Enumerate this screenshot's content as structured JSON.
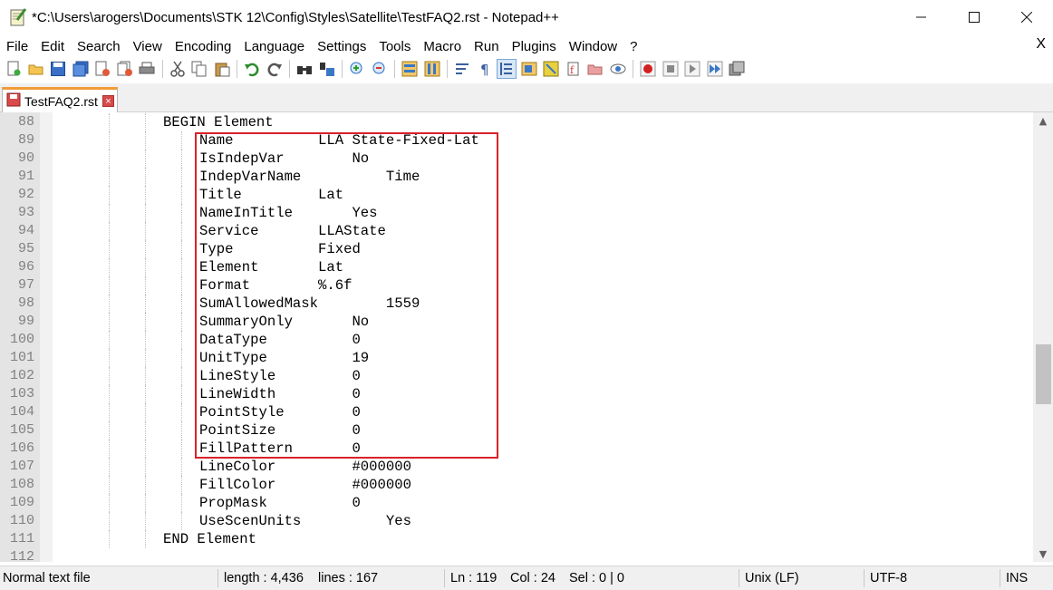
{
  "window": {
    "title": "*C:\\Users\\arogers\\Documents\\STK 12\\Config\\Styles\\Satellite\\TestFAQ2.rst - Notepad++",
    "minimize_icon": "minimize-icon",
    "maximize_icon": "maximize-icon",
    "close_icon": "close-icon"
  },
  "menu": {
    "items": [
      "File",
      "Edit",
      "Search",
      "View",
      "Encoding",
      "Language",
      "Settings",
      "Tools",
      "Macro",
      "Run",
      "Plugins",
      "Window",
      "?"
    ],
    "close_label": "X"
  },
  "toolbar": {
    "buttons": [
      "new-file-icon",
      "open-file-icon",
      "save-icon",
      "save-all-icon",
      "close-icon",
      "close-all-icon",
      "print-icon",
      "cut-icon",
      "copy-icon",
      "paste-icon",
      "undo-icon",
      "redo-icon",
      "find-icon",
      "replace-icon",
      "zoom-in-icon",
      "zoom-out-icon",
      "sync-vertical-icon",
      "sync-horizontal-icon",
      "word-wrap-icon",
      "show-all-chars-icon",
      "indent-guide-icon",
      "document-map-icon",
      "function-list-icon",
      "folder-as-workspace-icon",
      "monitoring-icon",
      "record-macro-icon",
      "stop-macro-icon",
      "play-macro-icon",
      "run-macro-multiple-icon",
      "save-macro-icon"
    ]
  },
  "tab": {
    "label": "TestFAQ2.rst",
    "icon": "save-disk-icon",
    "close": "×"
  },
  "editor": {
    "lines": [
      {
        "num": "88",
        "indent": 3,
        "text": "BEGIN Element"
      },
      {
        "num": "89",
        "indent": 4,
        "text": "Name          LLA State-Fixed-Lat"
      },
      {
        "num": "90",
        "indent": 4,
        "text": "IsIndepVar        No"
      },
      {
        "num": "91",
        "indent": 4,
        "text": "IndepVarName          Time"
      },
      {
        "num": "92",
        "indent": 4,
        "text": "Title         Lat"
      },
      {
        "num": "93",
        "indent": 4,
        "text": "NameInTitle       Yes"
      },
      {
        "num": "94",
        "indent": 4,
        "text": "Service       LLAState"
      },
      {
        "num": "95",
        "indent": 4,
        "text": "Type          Fixed"
      },
      {
        "num": "96",
        "indent": 4,
        "text": "Element       Lat"
      },
      {
        "num": "97",
        "indent": 4,
        "text": "Format        %.6f"
      },
      {
        "num": "98",
        "indent": 4,
        "text": "SumAllowedMask        1559"
      },
      {
        "num": "99",
        "indent": 4,
        "text": "SummaryOnly       No"
      },
      {
        "num": "100",
        "indent": 4,
        "text": "DataType          0"
      },
      {
        "num": "101",
        "indent": 4,
        "text": "UnitType          19"
      },
      {
        "num": "102",
        "indent": 4,
        "text": "LineStyle         0"
      },
      {
        "num": "103",
        "indent": 4,
        "text": "LineWidth         0"
      },
      {
        "num": "104",
        "indent": 4,
        "text": "PointStyle        0"
      },
      {
        "num": "105",
        "indent": 4,
        "text": "PointSize         0"
      },
      {
        "num": "106",
        "indent": 4,
        "text": "FillPattern       0"
      },
      {
        "num": "107",
        "indent": 4,
        "text": "LineColor         #000000"
      },
      {
        "num": "108",
        "indent": 4,
        "text": "FillColor         #000000"
      },
      {
        "num": "109",
        "indent": 4,
        "text": "PropMask          0"
      },
      {
        "num": "110",
        "indent": 4,
        "text": "UseScenUnits          Yes"
      },
      {
        "num": "111",
        "indent": 3,
        "text": "END Element"
      },
      {
        "num": "112",
        "indent": 0,
        "text": ""
      }
    ]
  },
  "status": {
    "file_type": "Normal text file",
    "length": "length : 4,436",
    "lines": "lines : 167",
    "ln": "Ln : 119",
    "col": "Col : 24",
    "sel": "Sel : 0 | 0",
    "eol": "Unix (LF)",
    "encoding": "UTF-8",
    "mode": "INS"
  },
  "colors": {
    "highlight_border": "#d9222a",
    "tab_accent": "#f29c38"
  }
}
